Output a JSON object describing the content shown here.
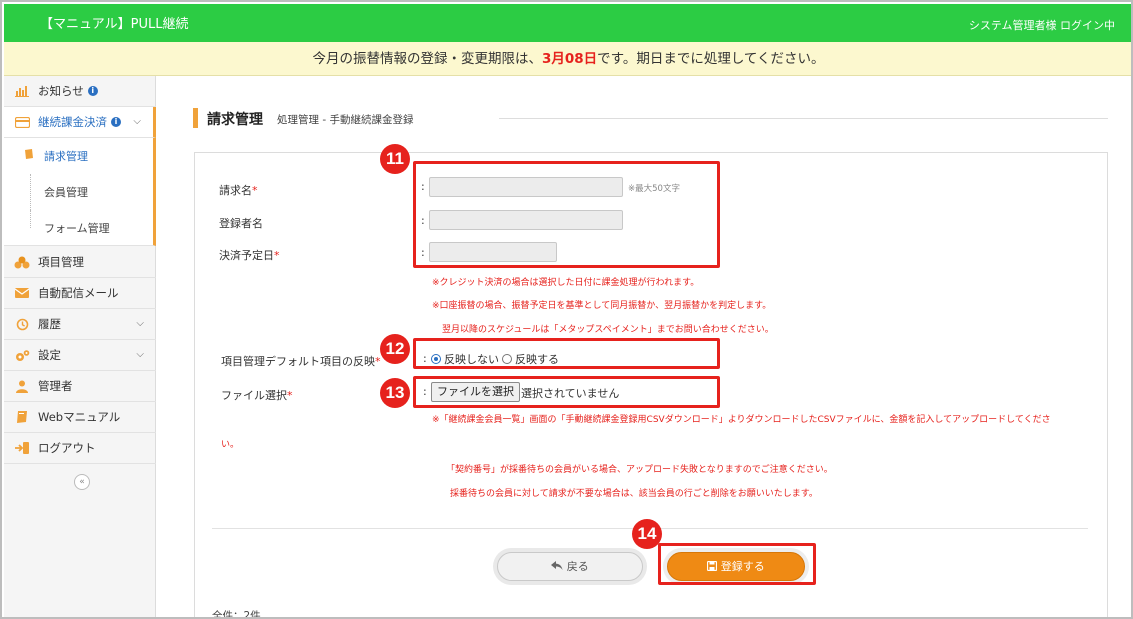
{
  "header": {
    "app_title": "【マニュアル】PULL継続",
    "login_status": "システム管理者様 ログイン中",
    "bg_color": "#2ccc44"
  },
  "notice": {
    "prefix": "今月の振替情報の登録・変更期限は、",
    "deadline": "3月08日",
    "suffix": "です。期日までに処理してください。"
  },
  "sidebar": {
    "items": [
      {
        "label": "お知らせ",
        "icon": "bar-chart-icon",
        "info": "i"
      },
      {
        "label": "継続課金決済",
        "icon": "credit-card-icon",
        "info": "i"
      },
      {
        "label": "項目管理",
        "icon": "coins-icon"
      },
      {
        "label": "自動配信メール",
        "icon": "envelope-icon"
      },
      {
        "label": "履歴",
        "icon": "history-icon"
      },
      {
        "label": "設定",
        "icon": "gears-icon"
      },
      {
        "label": "管理者",
        "icon": "user-icon"
      },
      {
        "label": "Webマニュアル",
        "icon": "book-icon"
      },
      {
        "label": "ログアウト",
        "icon": "sign-out-icon"
      }
    ],
    "subitems": [
      {
        "label": "請求管理"
      },
      {
        "label": "会員管理"
      },
      {
        "label": "フォーム管理"
      }
    ],
    "collapse_glyph": "«"
  },
  "page": {
    "title": "請求管理",
    "breadcrumb": "処理管理 - 手動継続課金登録"
  },
  "form": {
    "billing_name_label": "請求名",
    "billing_name_value": "",
    "billing_name_hint": "※最大50文字",
    "registrant_label": "登録者名",
    "registrant_value": "",
    "payment_date_label": "決済予定日",
    "payment_date_value": "",
    "required_mark": "*",
    "colon": ":",
    "notes_payment": [
      "※クレジット決済の場合は選択した日付に課金処理が行われます。",
      "※口座振替の場合、振替予定日を基準として同月振替か、翌月振替かを判定します。",
      "翌月以降のスケジュールは「メタップスペイメント」までお問い合わせください。"
    ],
    "default_reflect_label": "項目管理デフォルト項目の反映",
    "radio_no": "反映しない",
    "radio_yes": "反映する",
    "file_label": "ファイル選択",
    "file_button": "ファイルを選択",
    "file_status": "選択されていません",
    "notes_file": [
      "※「継続課金会員一覧」画面の「手動継続課金登録用CSVダウンロード」よりダウンロードしたCSVファイルに、金額を記入してアップロードしてくださ",
      "い。",
      "「契約番号」が採番待ちの会員がいる場合、アップロード失敗となりますのでご注意ください。",
      "採番待ちの会員に対して請求が不要な場合は、該当会員の行ごと削除をお願いいたします。"
    ]
  },
  "buttons": {
    "back": "戻る",
    "save": "登録する"
  },
  "annotations": {
    "badge_11": "11",
    "badge_12": "12",
    "badge_13": "13",
    "badge_14": "14",
    "color": "#e6221d"
  },
  "footer": {
    "count": "全件：2件"
  }
}
